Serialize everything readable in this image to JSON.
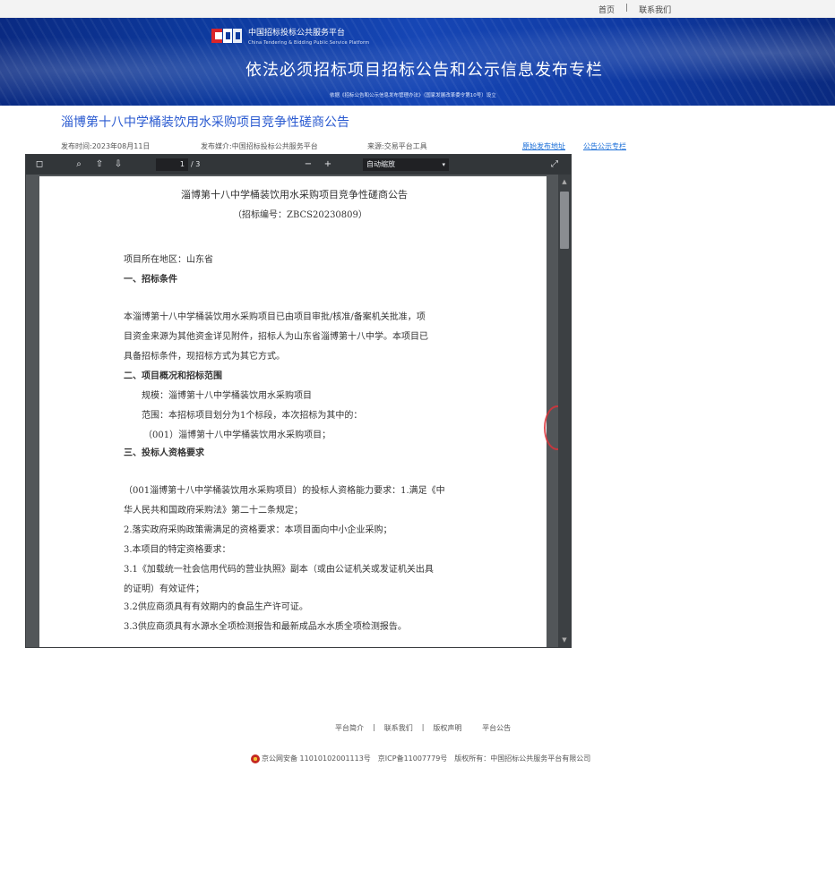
{
  "topbar": {
    "home": "首页",
    "separator": "|",
    "contact": "联系我们"
  },
  "banner": {
    "logo_cn": "中国招标投标公共服务平台",
    "logo_en": "China Tendering & Bidding Public Service Platform",
    "main_title": "依法必须招标项目招标公告和公示信息发布专栏",
    "sub_title": "依据《招标公告和公示信息发布管理办法》（国家发展改革委令第10号）设立"
  },
  "notice": {
    "title": "淄博第十八中学桶装饮用水采购项目竞争性磋商公告",
    "publish_time": "发布时间:2023年08月11日",
    "source": "发布媒介:中国招标投标公共服务平台",
    "tool": "来源:交易平台工具",
    "original_link": "原始发布地址",
    "notice_column": "公告公示专栏"
  },
  "viewer": {
    "page_current": "1",
    "page_total": "/ 3",
    "zoom": "自动缩放"
  },
  "document": {
    "title": "淄博第十八中学桶装饮用水采购项目竞争性磋商公告",
    "bid_no": "（招标编号：ZBCS20230809）",
    "region": "项目所在地区：山东省",
    "section1": "一、招标条件",
    "p1_l1": "本淄博第十八中学桶装饮用水采购项目已由项目审批/核准/备案机关批准，项",
    "p1_l2": "目资金来源为其他资金详见附件，招标人为山东省淄博第十八中学。本项目已",
    "p1_l3": "具备招标条件，现招标方式为其它方式。",
    "section2": "二、项目概况和招标范围",
    "scale": "规模：淄博第十八中学桶装饮用水采购项目",
    "scope": "范围：本招标项目划分为1个标段，本次招标为其中的：",
    "lot": "（001）淄博第十八中学桶装饮用水采购项目；",
    "section3": "三、投标人资格要求",
    "q_l1": "（001淄博第十八中学桶装饮用水采购项目）的投标人资格能力要求：1.满足《中",
    "q_l2": "华人民共和国政府采购法》第二十二条规定；",
    "q_l3": "2.落实政府采购政策需满足的资格要求：本项目面向中小企业采购；",
    "q_l4": "3.本项目的特定资格要求：",
    "q_l5": "3.1《加载统一社会信用代码的营业执照》副本（或由公证机关或发证机关出具",
    "q_l6": "的证明）有效证件；",
    "q_l7": "3.2供应商须具有有效期内的食品生产许可证。",
    "q_l8": "3.3供应商须具有水源水全项检测报告和最新成品水水质全项检测报告。"
  },
  "footer": {
    "about": "平台简介",
    "contact": "联系我们",
    "copyright": "版权声明",
    "announcement": "平台公告",
    "separator": "|",
    "icp": "京公网安备 11010102001113号　京ICP备11007779号　版权所有：中国招标公共服务平台有限公司"
  },
  "colors": {
    "banner_blue": "#0d3a9e",
    "title_blue": "#2a5ad0",
    "link_blue": "#1a6ed8",
    "viewer_toolbar": "#323639",
    "viewer_bg": "#525659"
  }
}
